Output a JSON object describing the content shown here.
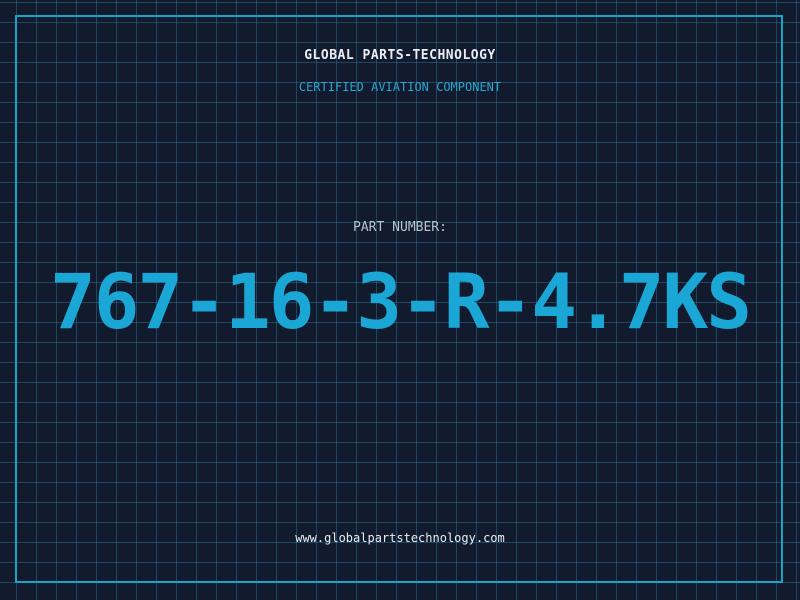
{
  "header": {
    "company": "GLOBAL PARTS-TECHNOLOGY",
    "subtitle": "CERTIFIED AVIATION COMPONENT"
  },
  "part": {
    "label": "PART NUMBER:",
    "number": "767-16-3-R-4.7KS"
  },
  "footer": {
    "website": "www.globalpartstechnology.com"
  },
  "colors": {
    "background": "#121a2e",
    "grid": "#286e8c",
    "accent": "#1aa7d6",
    "text": "#e9eef5"
  }
}
